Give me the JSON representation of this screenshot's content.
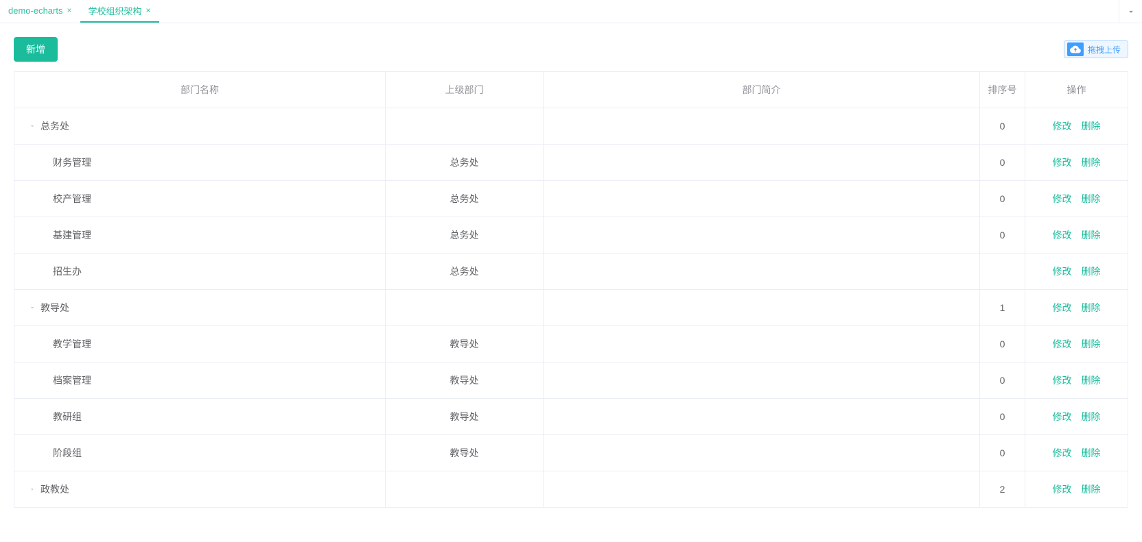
{
  "tabs": [
    {
      "label": "demo-echarts",
      "active": false
    },
    {
      "label": "学校组织架构",
      "active": true
    }
  ],
  "toolbar": {
    "add_label": "新增",
    "upload_label": "拖拽上传"
  },
  "columns": {
    "name": "部门名称",
    "parent": "上级部门",
    "desc": "部门简介",
    "order": "排序号",
    "ops": "操作"
  },
  "ops": {
    "edit": "修改",
    "delete": "删除"
  },
  "rows": [
    {
      "name": "总务处",
      "parent": "",
      "desc": "",
      "order": "0",
      "level": 0,
      "hasChildren": true,
      "expanded": true
    },
    {
      "name": "财务管理",
      "parent": "总务处",
      "desc": "",
      "order": "0",
      "level": 1,
      "hasChildren": false,
      "expanded": false
    },
    {
      "name": "校产管理",
      "parent": "总务处",
      "desc": "",
      "order": "0",
      "level": 1,
      "hasChildren": false,
      "expanded": false
    },
    {
      "name": "基建管理",
      "parent": "总务处",
      "desc": "",
      "order": "0",
      "level": 1,
      "hasChildren": false,
      "expanded": false
    },
    {
      "name": "招生办",
      "parent": "总务处",
      "desc": "",
      "order": "",
      "level": 1,
      "hasChildren": false,
      "expanded": false
    },
    {
      "name": "教导处",
      "parent": "",
      "desc": "",
      "order": "1",
      "level": 0,
      "hasChildren": true,
      "expanded": true
    },
    {
      "name": "教学管理",
      "parent": "教导处",
      "desc": "",
      "order": "0",
      "level": 1,
      "hasChildren": false,
      "expanded": false
    },
    {
      "name": "档案管理",
      "parent": "教导处",
      "desc": "",
      "order": "0",
      "level": 1,
      "hasChildren": false,
      "expanded": false
    },
    {
      "name": "教研组",
      "parent": "教导处",
      "desc": "",
      "order": "0",
      "level": 1,
      "hasChildren": false,
      "expanded": false
    },
    {
      "name": "阶段组",
      "parent": "教导处",
      "desc": "",
      "order": "0",
      "level": 1,
      "hasChildren": false,
      "expanded": false
    },
    {
      "name": "政教处",
      "parent": "",
      "desc": "",
      "order": "2",
      "level": 0,
      "hasChildren": true,
      "expanded": false
    }
  ]
}
